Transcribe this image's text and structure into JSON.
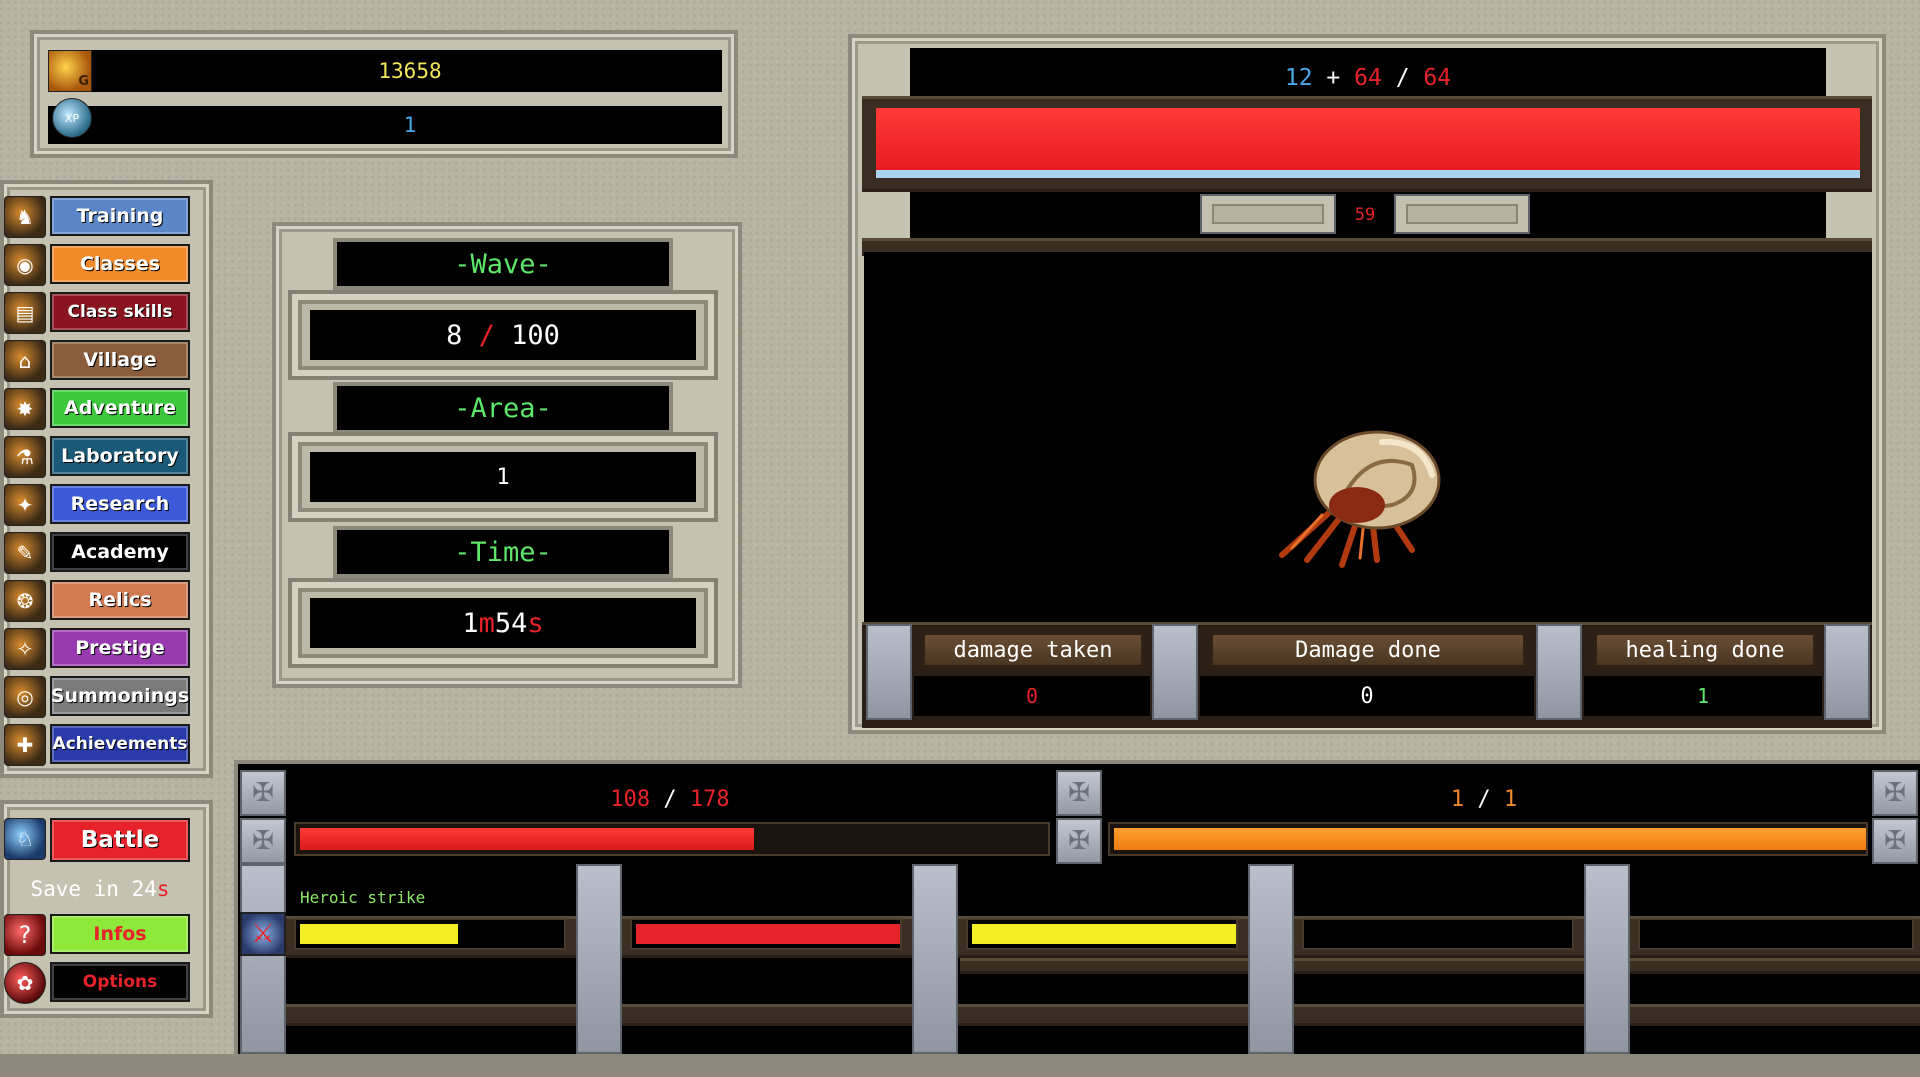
{
  "resources": {
    "gold_value": "13658",
    "xp_value": "1",
    "gold_icon_text": "G",
    "xp_icon_text": "XP"
  },
  "menu": [
    {
      "label": "Training",
      "color": "#5a86c8",
      "icon": "training-icon",
      "glyph": "♞"
    },
    {
      "label": "Classes",
      "color": "#f08a2a",
      "icon": "classes-icon",
      "glyph": "◉"
    },
    {
      "label": "Class skills",
      "color": "#8a1420",
      "icon": "class-skills-icon",
      "glyph": "▤"
    },
    {
      "label": "Village",
      "color": "#8a5e3c",
      "icon": "village-icon",
      "glyph": "⌂"
    },
    {
      "label": "Adventure",
      "color": "#3cc83c",
      "icon": "adventure-icon",
      "glyph": "✸"
    },
    {
      "label": "Laboratory",
      "color": "#1a5a78",
      "icon": "laboratory-icon",
      "glyph": "⚗"
    },
    {
      "label": "Research",
      "color": "#3c5ad8",
      "icon": "research-icon",
      "glyph": "✦"
    },
    {
      "label": "Academy",
      "color": "#000000",
      "icon": "academy-icon",
      "glyph": "✎"
    },
    {
      "label": "Relics",
      "color": "#d07a52",
      "icon": "relics-icon",
      "glyph": "❂"
    },
    {
      "label": "Prestige",
      "color": "#9a3ab0",
      "icon": "prestige-icon",
      "glyph": "✧"
    },
    {
      "label": "Summonings",
      "color": "#7a7a7a",
      "icon": "summonings-icon",
      "glyph": "◎"
    },
    {
      "label": "Achievements",
      "color": "#2a3aa8",
      "icon": "achievements-icon",
      "glyph": "✚"
    }
  ],
  "bottom_menu": {
    "battle_label": "Battle",
    "battle_color": "#e8222a",
    "save_prefix": "Save in 24",
    "save_suffix": "s",
    "infos_label": "Infos",
    "infos_color": "#8ee83a",
    "options_label": "Options",
    "options_color": "#000000"
  },
  "wave": {
    "title": "-Wave-",
    "current": "8",
    "separator": "/",
    "total": "100"
  },
  "area": {
    "title": "-Area-",
    "value": "1"
  },
  "time": {
    "title": "-Time-",
    "min": "1",
    "min_unit": "m",
    "sec": "54",
    "sec_unit": "s"
  },
  "enemy": {
    "hp_a": "12",
    "plus": "+",
    "hp_b": "64",
    "slash": "/",
    "hp_max": "64",
    "hp_fraction": 1.0,
    "timer": "59",
    "creature": "hermit-crab"
  },
  "stats": {
    "damage_taken_label": "damage taken",
    "damage_taken_value": "0",
    "damage_done_label": "Damage done",
    "damage_done_value": "0",
    "healing_done_label": "healing done",
    "healing_done_value": "1"
  },
  "player": {
    "hp_current": "108",
    "hp_sep": "/",
    "hp_max": "178",
    "hp_fraction": 0.607,
    "mp_current": "1",
    "mp_sep": "/",
    "mp_max": "1",
    "mp_fraction": 1.0
  },
  "skills": [
    {
      "name": "Heroic strike",
      "fill": 0.6,
      "color": "#f2ee22"
    },
    {
      "name": "",
      "fill": 1.0,
      "color": "#e8222a"
    },
    {
      "name": "",
      "fill": 1.0,
      "color": "#f2ee22"
    }
  ]
}
